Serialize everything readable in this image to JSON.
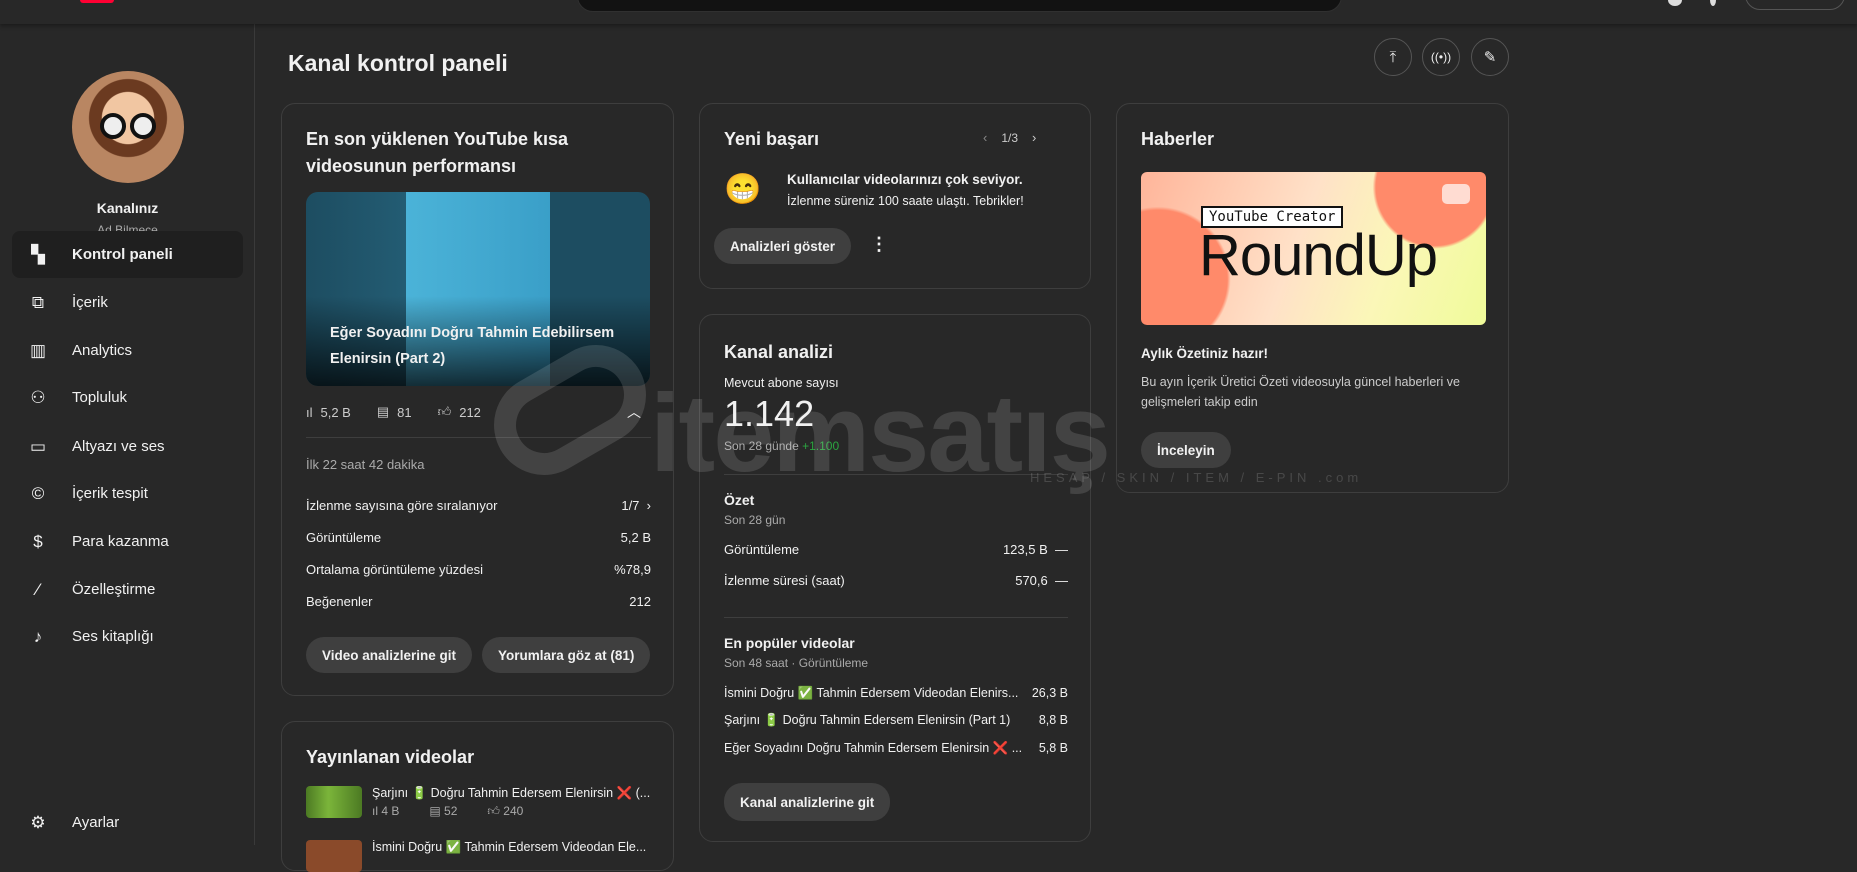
{
  "sidebar": {
    "channel_name": "Kanalınız",
    "channel_sub": "Ad Bilmece",
    "items": [
      {
        "label": "Kontrol paneli",
        "icon": "dashboard-icon"
      },
      {
        "label": "İçerik",
        "icon": "content-icon"
      },
      {
        "label": "Analytics",
        "icon": "analytics-icon"
      },
      {
        "label": "Topluluk",
        "icon": "community-icon"
      },
      {
        "label": "Altyazı ve ses",
        "icon": "subtitles-icon"
      },
      {
        "label": "İçerik tespit",
        "icon": "copyright-icon"
      },
      {
        "label": "Para kazanma",
        "icon": "dollar-icon"
      },
      {
        "label": "Özelleştirme",
        "icon": "magic-wand-icon"
      },
      {
        "label": "Ses kitaplığı",
        "icon": "audio-library-icon"
      }
    ],
    "settings": "Ayarlar"
  },
  "page": {
    "title": "Kanal kontrol paneli"
  },
  "latest_short": {
    "title": "En son yüklenen YouTube kısa videosunun performansı",
    "video_title": "Eğer Soyadını Doğru Tahmin Edebilirsem Elenirsin (Part 2)",
    "views": "5,2 B",
    "comments": "81",
    "likes": "212",
    "period": "İlk 22 saat 42 dakika",
    "sort_label": "İzlenme sayısına göre sıralanıyor",
    "sort_page": "1/7",
    "rows": [
      {
        "label": "Görüntüleme",
        "value": "5,2 B"
      },
      {
        "label": "Ortalama görüntüleme yüzdesi",
        "value": "%78,9"
      },
      {
        "label": "Beğenenler",
        "value": "212"
      }
    ],
    "btn_analytics": "Video analizlerine git",
    "btn_comments": "Yorumlara göz at (81)"
  },
  "published": {
    "title": "Yayınlanan videolar",
    "items": [
      {
        "title": "Şarjını 🔋 Doğru Tahmin Edersem Elenirsin ❌ (...",
        "views": "4 B",
        "comments": "52",
        "likes": "240"
      },
      {
        "title": "İsmini Doğru ✅ Tahmin Edersem Videodan Ele..."
      }
    ]
  },
  "achievement": {
    "title": "Yeni başarı",
    "pager": "1/3",
    "headline": "Kullanıcılar videolarınızı çok seviyor.",
    "detail": "İzlenme süreniz 100 saate ulaştı. Tebrikler!",
    "button": "Analizleri göster"
  },
  "analytics": {
    "title": "Kanal analizi",
    "subs_label": "Mevcut abone sayısı",
    "subs": "1.142",
    "subs_period": "Son 28 günde",
    "subs_delta": "+1.100",
    "summary_title": "Özet",
    "summary_period": "Son 28 gün",
    "summary": [
      {
        "label": "Görüntüleme",
        "value": "123,5 B",
        "trend": "—"
      },
      {
        "label": "İzlenme süresi (saat)",
        "value": "570,6",
        "trend": "—"
      }
    ],
    "top_title": "En popüler videolar",
    "top_period": "Son 48 saat · Görüntüleme",
    "top": [
      {
        "title": "İsmini Doğru ✅ Tahmin Edersem Videodan Elenirs...",
        "value": "26,3 B"
      },
      {
        "title": "Şarjını 🔋 Doğru Tahmin Edersem Elenirsin (Part 1)",
        "value": "8,8 B"
      },
      {
        "title": "Eğer Soyadını Doğru Tahmin Edersem Elenirsin ❌ ...",
        "value": "5,8 B"
      }
    ],
    "button": "Kanal analizlerine git"
  },
  "news": {
    "title": "Haberler",
    "image_tag": "YouTube Creator",
    "image_title": "RoundUp",
    "headline": "Aylık Özetiniz hazır!",
    "desc": "Bu ayın İçerik Üretici Özeti videosuyla güncel haberleri ve gelişmeleri takip edin",
    "button": "İnceleyin"
  },
  "watermark": {
    "text": "itemsatış",
    "tag": "HESAP / SKIN / ITEM / E-PIN .com"
  },
  "colors": {
    "bg": "#282828",
    "border": "#3e3e3e",
    "button": "#3f3f3f",
    "positive": "#2ba640"
  }
}
